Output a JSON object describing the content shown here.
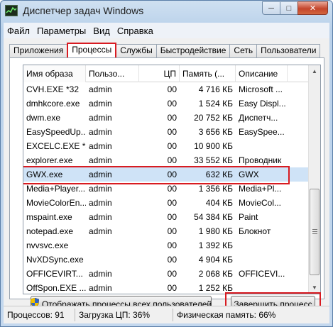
{
  "window": {
    "title": "Диспетчер задач Windows"
  },
  "menu": [
    "Файл",
    "Параметры",
    "Вид",
    "Справка"
  ],
  "tabs": [
    "Приложения",
    "Процессы",
    "Службы",
    "Быстродействие",
    "Сеть",
    "Пользователи"
  ],
  "active_tab": "Процессы",
  "columns": [
    "Имя образа",
    "Пользо...",
    "ЦП",
    "Память (...",
    "Описание"
  ],
  "rows": [
    [
      "CVH.EXE *32",
      "admin",
      "00",
      "4 716 КБ",
      "Microsoft ..."
    ],
    [
      "dmhkcore.exe",
      "admin",
      "00",
      "1 524 КБ",
      "Easy Displ..."
    ],
    [
      "dwm.exe",
      "admin",
      "00",
      "20 752 КБ",
      "Диспетч..."
    ],
    [
      "EasySpeedUp...",
      "admin",
      "00",
      "3 656 КБ",
      "EasySpee..."
    ],
    [
      "EXCELC.EXE *32",
      "admin",
      "00",
      "10 900 КБ",
      ""
    ],
    [
      "explorer.exe",
      "admin",
      "00",
      "33 552 КБ",
      "Проводник"
    ],
    [
      "GWX.exe",
      "admin",
      "00",
      "632 КБ",
      "GWX"
    ],
    [
      "Media+Player...",
      "admin",
      "00",
      "1 356 КБ",
      "Media+Pl..."
    ],
    [
      "MovieColorEn...",
      "admin",
      "00",
      "404 КБ",
      "MovieCol..."
    ],
    [
      "mspaint.exe",
      "admin",
      "00",
      "54 384 КБ",
      "Paint"
    ],
    [
      "notepad.exe",
      "admin",
      "00",
      "1 980 КБ",
      "Блокнот"
    ],
    [
      "nvvsvc.exe",
      "",
      "00",
      "1 392 КБ",
      ""
    ],
    [
      "NvXDSync.exe",
      "",
      "00",
      "4 904 КБ",
      ""
    ],
    [
      "OFFICEVIRT...",
      "admin",
      "00",
      "2 068 КБ",
      "OFFICEVI..."
    ],
    [
      "OffSpon.EXE ...",
      "admin",
      "00",
      "1 252 КБ",
      ""
    ]
  ],
  "selected_row": "GWX.exe",
  "buttons": {
    "show_all": "Отображать процессы всех пользователей",
    "end_process": "Завершить процесс"
  },
  "status": {
    "processes": "Процессов: 91",
    "cpu": "Загрузка ЦП: 36%",
    "memory": "Физическая память: 66%"
  },
  "colors": {
    "highlight": "#d81b21",
    "selection": "#cfe3f7"
  },
  "icons": {
    "app": "task-manager-icon",
    "uac": "uac-shield-icon"
  }
}
